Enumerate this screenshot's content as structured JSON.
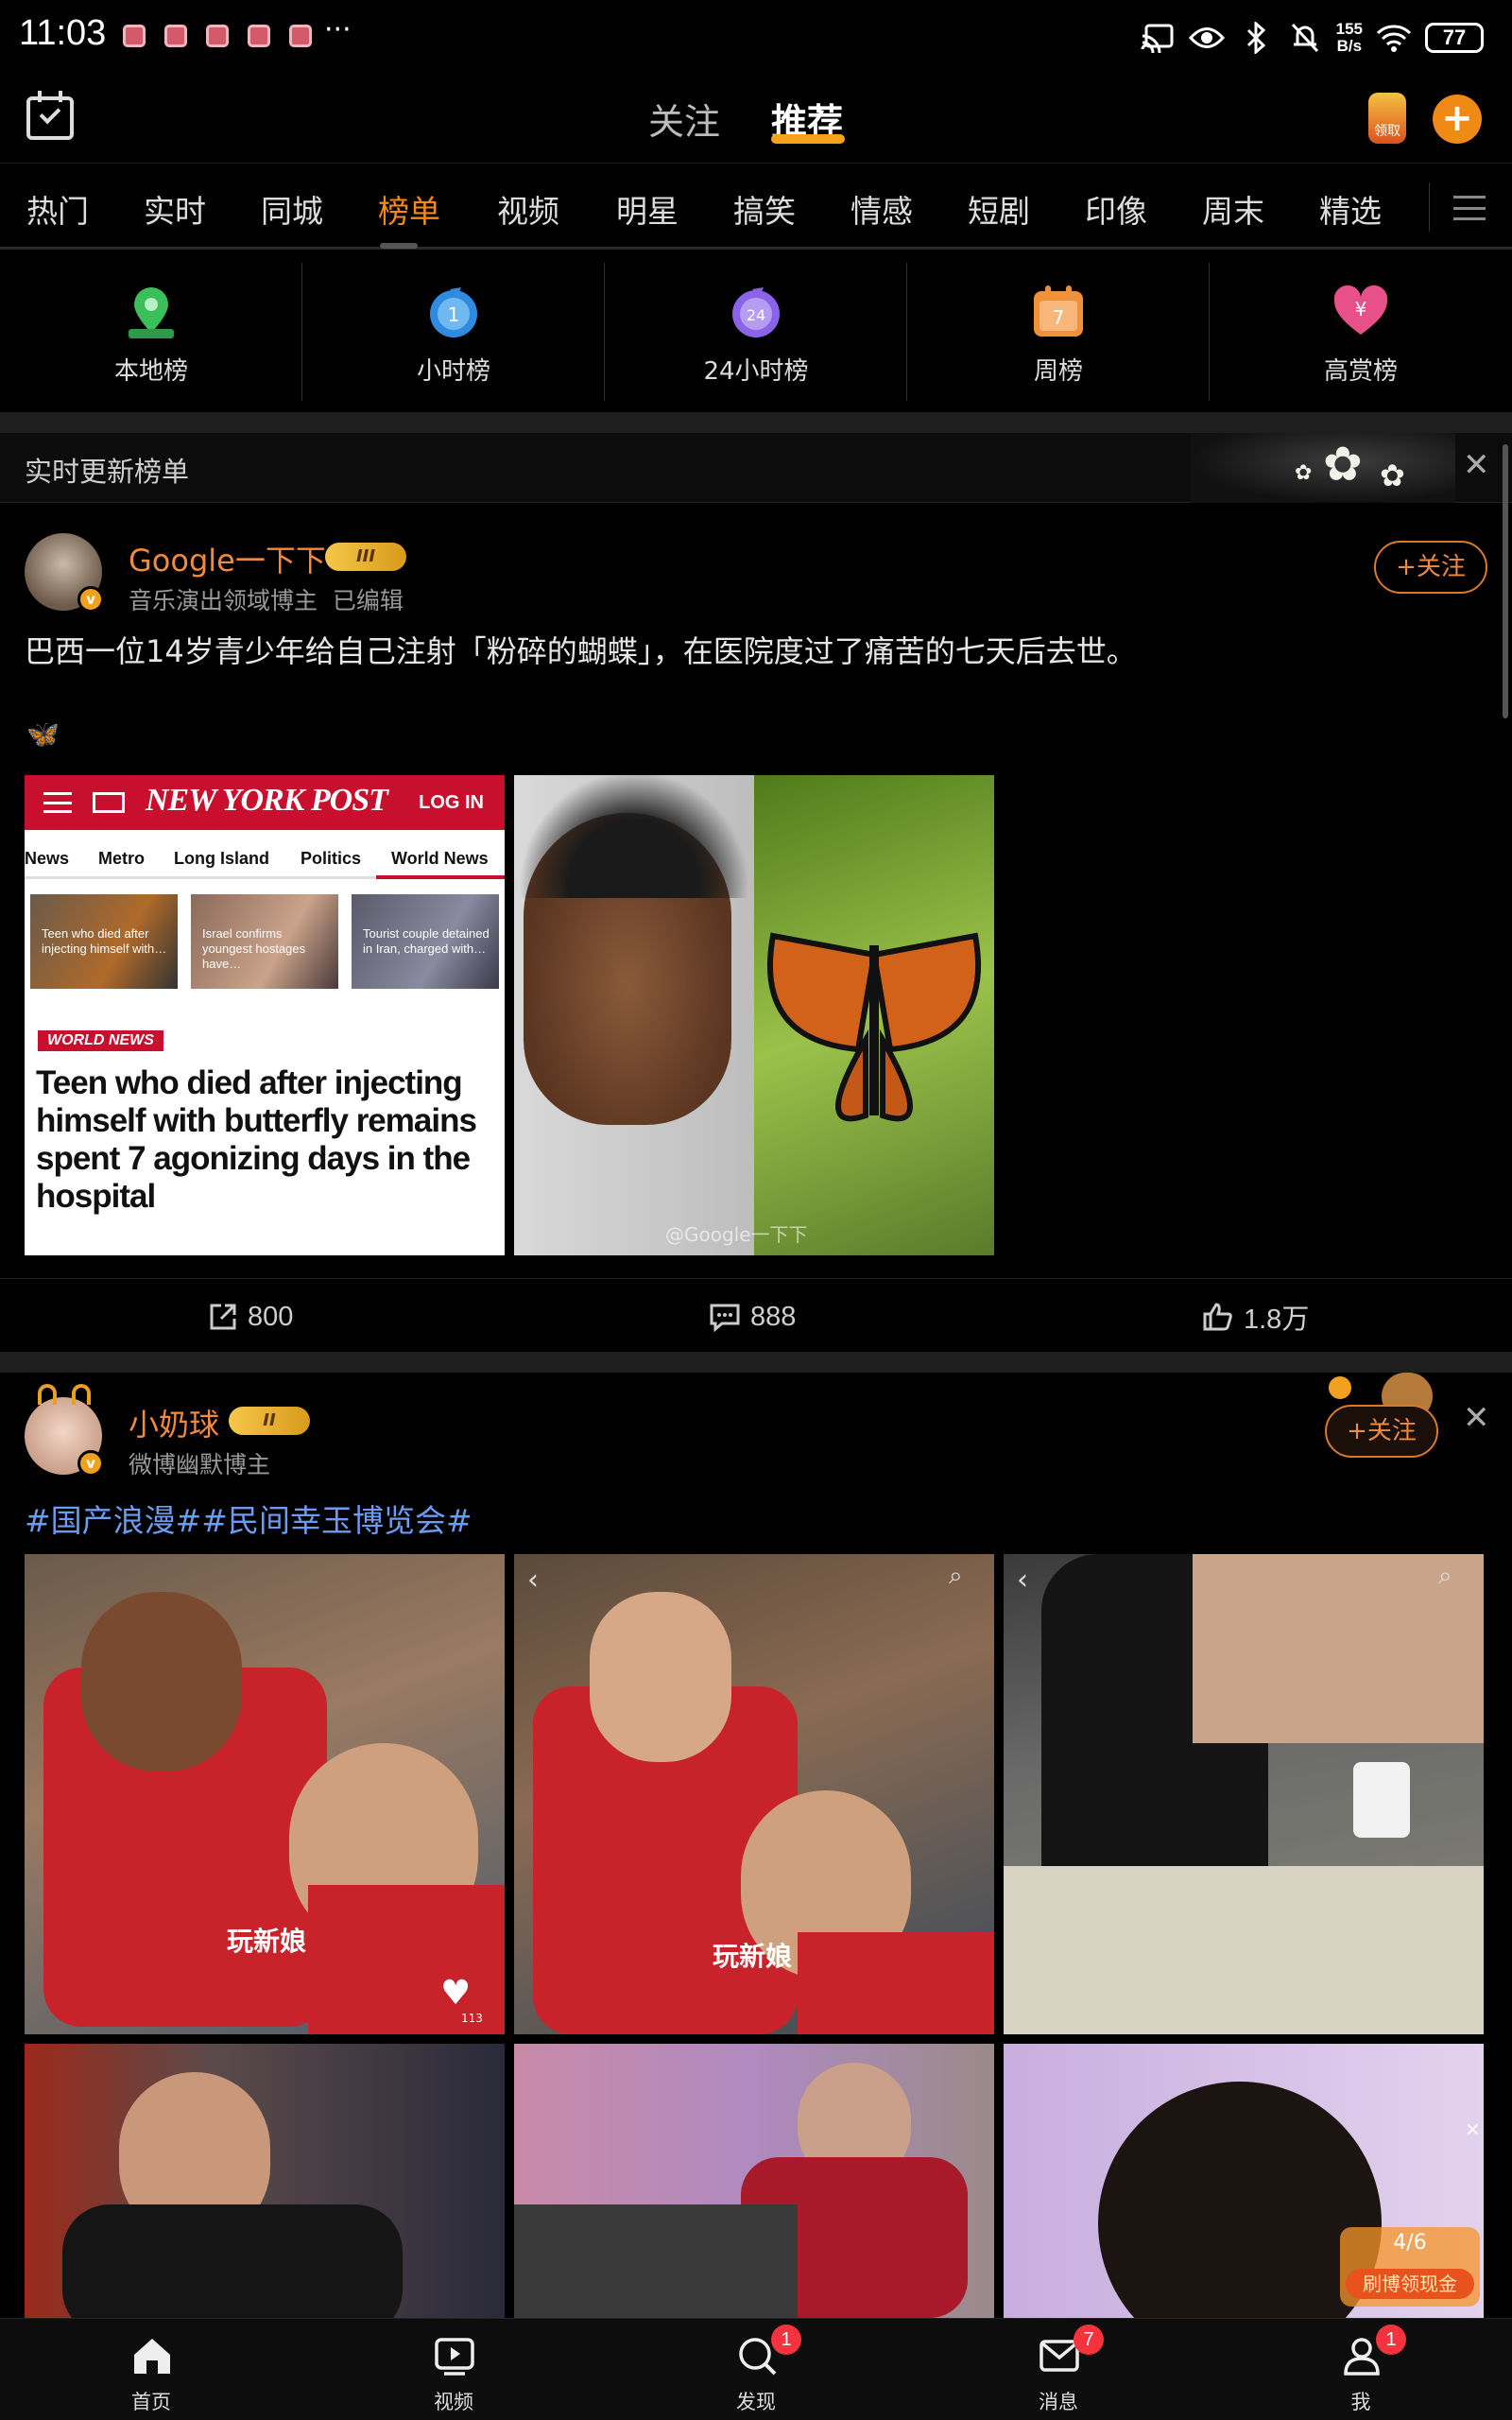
{
  "status_bar": {
    "time": "11:03",
    "more": "···",
    "net_speed_value": "155",
    "net_speed_unit": "B/s",
    "battery": "77"
  },
  "header": {
    "tabs": [
      "关注",
      "推荐"
    ],
    "active_tab": "推荐",
    "coin_label": "领取",
    "add_label": "+"
  },
  "categories": [
    "热门",
    "实时",
    "同城",
    "榜单",
    "视频",
    "明星",
    "搞笑",
    "情感",
    "短剧",
    "印像",
    "周末",
    "精选"
  ],
  "active_category": "榜单",
  "ranks": [
    {
      "label": "本地榜",
      "icon": "map-pin-icon",
      "color": "#3cbf5a"
    },
    {
      "label": "小时榜",
      "icon": "clock-icon",
      "color": "#2f8be0"
    },
    {
      "label": "24小时榜",
      "icon": "24h-icon",
      "color": "#8a63e8"
    },
    {
      "label": "周榜",
      "icon": "calendar-icon",
      "color": "#f0923a"
    },
    {
      "label": "高赏榜",
      "icon": "heart-yuan-icon",
      "color": "#e8508a"
    }
  ],
  "rank_icon_text": {
    "hour": "1",
    "day": "24",
    "week": "7",
    "reward": "¥"
  },
  "realtime_banner": {
    "title": "实时更新榜单"
  },
  "post1": {
    "author": "Google一下下",
    "vip_level": "III",
    "meta": "音乐演出领域博主",
    "edited": "已编辑",
    "follow": "+关注",
    "text": "巴西一位14岁青少年给自己注射「粉碎的蝴蝶」，在医院度过了痛苦的七天后去世。",
    "emoji": "🦋",
    "shares": "800",
    "comments": "888",
    "likes": "1.8万",
    "nyp": {
      "logo": "NEW YORK POST",
      "login": "LOG IN",
      "nav": [
        "News",
        "Metro",
        "Long Island",
        "Politics",
        "World News"
      ],
      "thumbs": [
        "Teen who died after injecting himself with…",
        "Israel confirms youngest hostages have…",
        "Tourist couple detained in Iran, charged with…"
      ],
      "tag": "WORLD NEWS",
      "headline": "Teen who died after injecting himself with butterfly remains spent 7 agonizing days in the hospital"
    },
    "watermark": "@Google一下下"
  },
  "post2": {
    "author": "小奶球",
    "vip_level": "II",
    "meta": "微博幽默博主",
    "follow": "+关注",
    "hashtags": "#国产浪漫##民间幸玉博览会#",
    "caption_1": "玩新娘",
    "caption_2": "玩新娘",
    "like_count": "113"
  },
  "float_badge": {
    "progress": "4/6",
    "text": "刷博领现金"
  },
  "bottom_nav": [
    {
      "label": "首页",
      "icon": "home-icon",
      "badge": ""
    },
    {
      "label": "视频",
      "icon": "video-icon",
      "badge": ""
    },
    {
      "label": "发现",
      "icon": "discover-icon",
      "badge": "1"
    },
    {
      "label": "消息",
      "icon": "message-icon",
      "badge": "7"
    },
    {
      "label": "我",
      "icon": "profile-icon",
      "badge": "1"
    }
  ]
}
